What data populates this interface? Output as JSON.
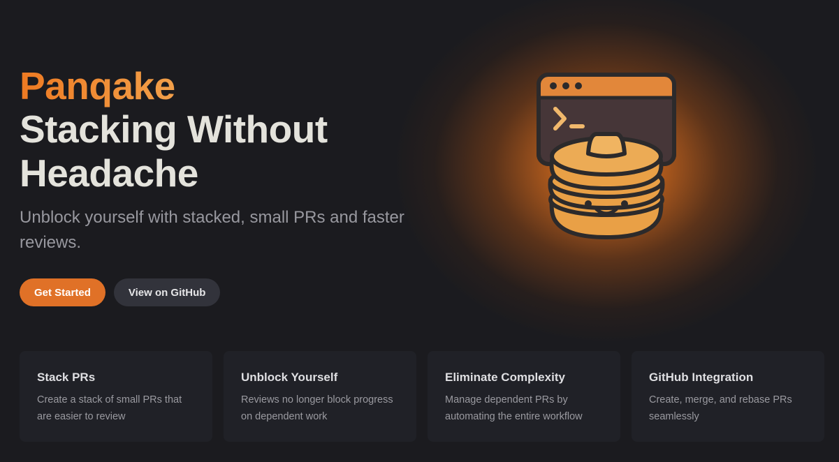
{
  "hero": {
    "brand": "Panqake",
    "headline_line1": "Stacking Without",
    "headline_line2": "Headache",
    "tagline": "Unblock yourself with stacked, small PRs and faster reviews."
  },
  "actions": {
    "primary_label": "Get Started",
    "secondary_label": "View on GitHub"
  },
  "logo": {
    "icon": "pancake-terminal-logo",
    "terminal_prompt": ">_"
  },
  "features": [
    {
      "title": "Stack PRs",
      "text": "Create a stack of small PRs that are easier to review"
    },
    {
      "title": "Unblock Yourself",
      "text": "Reviews no longer block progress on dependent work"
    },
    {
      "title": "Eliminate Complexity",
      "text": "Manage dependent PRs by automating the entire workflow"
    },
    {
      "title": "GitHub Integration",
      "text": "Create, merge, and rebase PRs seamlessly"
    }
  ],
  "colors": {
    "background": "#1b1b1f",
    "accent": "#e07127",
    "brand_gradient_start": "#ee7a22",
    "brand_gradient_end": "#f2a04a",
    "card_background": "#202127"
  }
}
